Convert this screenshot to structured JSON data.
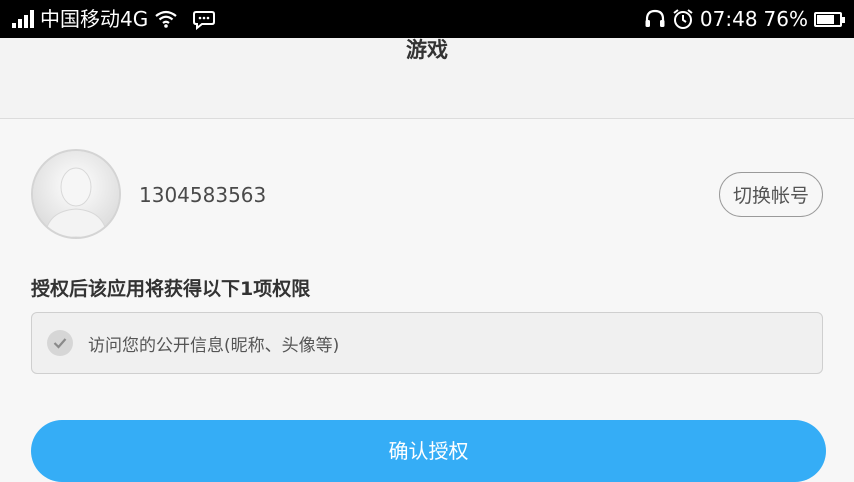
{
  "status_bar": {
    "carrier": "中国移动4G",
    "time": "07:48",
    "battery": "76%",
    "battery_level": 0.76,
    "icons": [
      "signal-icon",
      "wifi-icon",
      "chat-bubble-icon",
      "headphones-icon",
      "alarm-clock-icon",
      "battery-icon"
    ]
  },
  "header": {
    "title": "游戏"
  },
  "account": {
    "number": "1304583563",
    "switch_label": "切换帐号"
  },
  "permissions": {
    "title": "授权后该应用将获得以下1项权限",
    "items": [
      {
        "label": "访问您的公开信息(昵称、头像等)",
        "checked": true
      }
    ]
  },
  "confirm": {
    "label": "确认授权"
  },
  "colors": {
    "accent": "#35adf6",
    "statusbar": "#000000"
  }
}
